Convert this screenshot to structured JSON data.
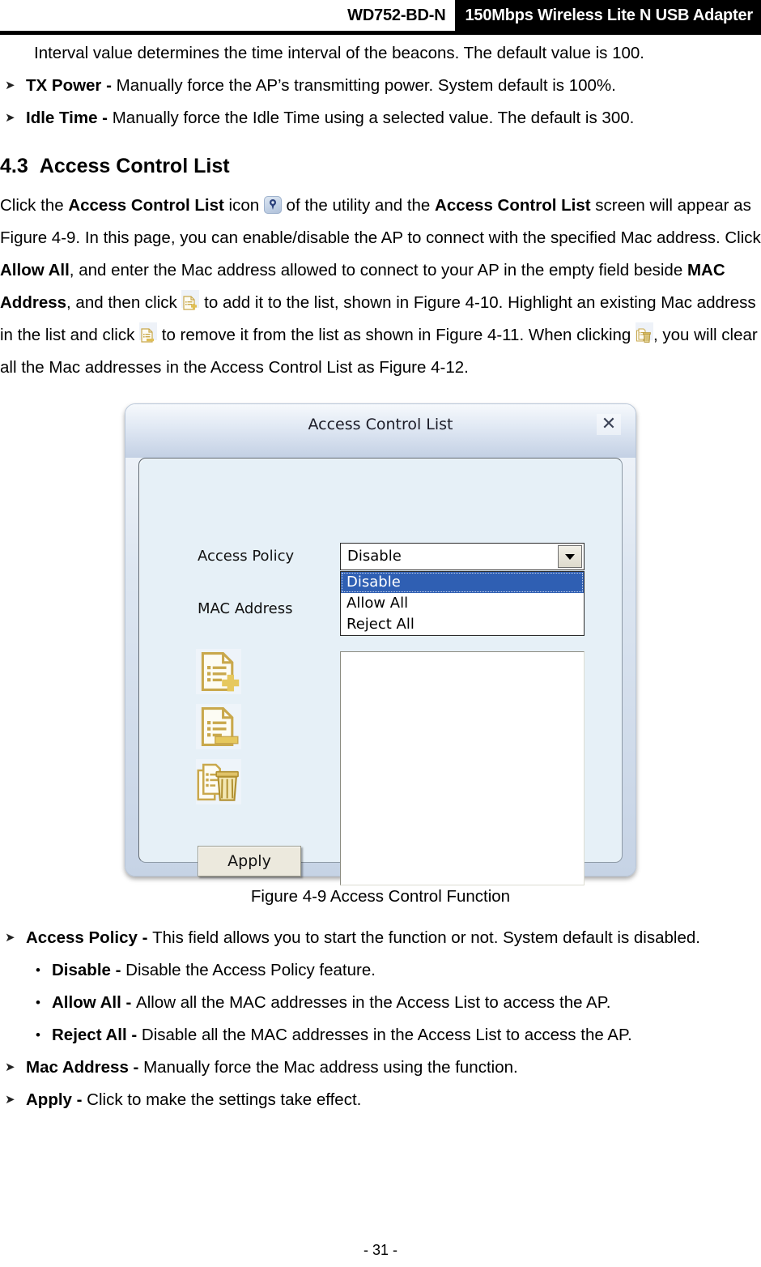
{
  "header": {
    "model": "WD752-BD-N",
    "product": "150Mbps Wireless Lite N USB Adapter"
  },
  "intro": {
    "beacon_line": "Interval value determines the time interval of the beacons. The default value is 100.",
    "bullets": [
      {
        "marker": "➤",
        "term": "TX Power - ",
        "desc": "Manually force the AP’s transmitting power. System default is 100%."
      },
      {
        "marker": "➤",
        "term": "Idle Time - ",
        "desc": "Manually force the Idle Time using a selected value. The default is 300."
      }
    ]
  },
  "section": {
    "number": "4.3",
    "title": "Access Control List"
  },
  "body_text": {
    "p1_a": "Click the ",
    "p1_b_bold": "Access Control List",
    "p1_c": " icon ",
    "p1_icon": "access-control-list-icon",
    "p1_d": " of the utility and the ",
    "p1_e_bold": "Access Control List",
    "p1_f": " screen will appear as Figure 4-9. In this page, you can enable/disable the AP to connect with the specified Mac address. Click ",
    "p1_g_bold": "Allow All",
    "p1_h": ", and enter the Mac address allowed to connect to your AP in the empty field beside ",
    "p1_i_bold": "MAC Address",
    "p1_j": ", and then click ",
    "p1_icon2": "document-add-icon",
    "p1_k": " to add it to the list, shown in Figure 4-10. Highlight an existing Mac address in the list and click ",
    "p1_icon3": "document-remove-icon",
    "p1_l": " to remove it from the list as shown in Figure 4-11. When clicking ",
    "p1_icon4": "delete-all-trash-icon",
    "p1_m": ", you will clear all the Mac addresses in the Access Control List as Figure 4-12."
  },
  "dialog": {
    "title": "Access Control List",
    "close_label": "✕",
    "access_policy_label": "Access Policy",
    "mac_address_label": "MAC Address",
    "combo_value": "Disable",
    "combo_options": [
      {
        "label": "Disable",
        "selected": true
      },
      {
        "label": "Allow All",
        "selected": false
      },
      {
        "label": "Reject All",
        "selected": false
      }
    ],
    "tool_icons": [
      {
        "name": "document-add-icon"
      },
      {
        "name": "document-remove-icon"
      },
      {
        "name": "delete-all-trash-icon"
      }
    ],
    "listbox_items": [],
    "apply_label": "Apply"
  },
  "figure": {
    "caption": "Figure 4-9 Access Control Function"
  },
  "definitions": [
    {
      "level": "arrow",
      "marker": "➤",
      "term": "Access Policy - ",
      "desc": "This field allows you to start the function or not. System default is disabled."
    },
    {
      "level": "dot",
      "marker": "•",
      "term": "Disable - ",
      "desc": "Disable the Access Policy feature."
    },
    {
      "level": "dot",
      "marker": "•",
      "term": "Allow All - ",
      "desc": "Allow all the MAC addresses in the Access List to access the AP."
    },
    {
      "level": "dot",
      "marker": "•",
      "term": "Reject All - ",
      "desc": "Disable all the MAC addresses in the Access List to access the AP."
    },
    {
      "level": "arrow",
      "marker": "➤",
      "term": "Mac Address - ",
      "desc": "Manually force the Mac address using the function."
    },
    {
      "level": "arrow",
      "marker": "➤",
      "term": "Apply - ",
      "desc": "Click to make the settings take effect."
    }
  ],
  "footer": {
    "page_number": "- 31 -"
  },
  "colors": {
    "header_bar": "#000000",
    "dialog_panel": "#e6f0f7",
    "combo_selected": "#2f5fb3",
    "icon_gold": "#c9a84c"
  }
}
